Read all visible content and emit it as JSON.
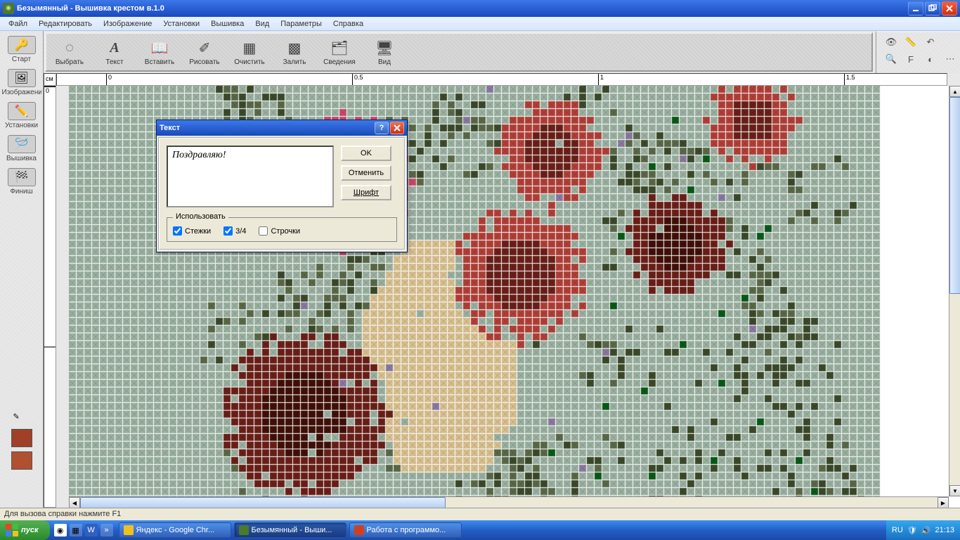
{
  "titlebar": {
    "title": "Безымянный - Вышивка крестом в.1.0"
  },
  "menubar": {
    "items": [
      "Файл",
      "Редактировать",
      "Изображение",
      "Установки",
      "Вышивка",
      "Вид",
      "Параметры",
      "Справка"
    ]
  },
  "toolbar": {
    "items": [
      {
        "label": "Выбрать",
        "icon": "select"
      },
      {
        "label": "Текст",
        "icon": "text"
      },
      {
        "label": "Вставить",
        "icon": "paste"
      },
      {
        "label": "Рисовать",
        "icon": "draw"
      },
      {
        "label": "Очистить",
        "icon": "clear"
      },
      {
        "label": "Залить",
        "icon": "fill"
      },
      {
        "label": "Сведения",
        "icon": "info"
      },
      {
        "label": "Вид",
        "icon": "view"
      }
    ]
  },
  "leftpane": {
    "items": [
      {
        "label": "Старт",
        "icon": "key"
      },
      {
        "label": "Изображение",
        "icon": "image"
      },
      {
        "label": "Установки",
        "icon": "settings"
      },
      {
        "label": "Вышивка",
        "icon": "stitch"
      },
      {
        "label": "Финиш",
        "icon": "finish"
      }
    ],
    "swatches": [
      "#a04028",
      "#b05030"
    ]
  },
  "ruler": {
    "unit": "см",
    "marks": [
      "0",
      "0.5",
      "1",
      "1.5"
    ]
  },
  "dialog": {
    "title": "Текст",
    "text_value": "Поздравляю!",
    "ok": "OK",
    "cancel": "Отменить",
    "font": "Шрифт",
    "use_group": "Использовать",
    "chk_stitches": "Стежки",
    "chk_34": "3/4",
    "chk_lines": "Строчки",
    "chk_stitches_val": true,
    "chk_34_val": true,
    "chk_lines_val": false
  },
  "statusbar": {
    "text": "Для вызова справки нажмите F1"
  },
  "taskbar": {
    "start": "пуск",
    "tasks": [
      {
        "label": "Яндекс - Google Chr...",
        "color": "#f0c020"
      },
      {
        "label": "Безымянный - Выши...",
        "color": "#4a7a2a",
        "active": true
      },
      {
        "label": "Работа с программо...",
        "color": "#d04020"
      }
    ],
    "lang": "RU",
    "time": "21:13"
  }
}
